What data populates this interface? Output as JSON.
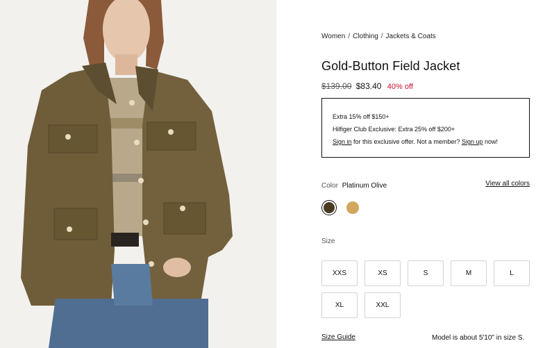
{
  "breadcrumb": {
    "items": [
      "Women",
      "Clothing",
      "Jackets & Coats"
    ],
    "separator": "/"
  },
  "product": {
    "title": "Gold-Button Field Jacket",
    "price_original": "$139.00",
    "price_sale": "$83.40",
    "discount": "40% off"
  },
  "promo": {
    "line1": "Extra 15% off $150+",
    "line2": "Hilfiger Club Exclusive: Extra 25% off $200+",
    "signin_link": "Sign in",
    "line3_middle": " for this exclusive offer. Not a member? ",
    "signup_link": "Sign up",
    "line3_end": " now!"
  },
  "color": {
    "label": "Color",
    "selected_name": "Platinum Olive",
    "view_all": "View all colors",
    "swatches": [
      {
        "name": "platinum-olive",
        "hex": "#4a3a22",
        "selected": true
      },
      {
        "name": "tan",
        "hex": "#d2a65c",
        "selected": false
      }
    ]
  },
  "size": {
    "label": "Size",
    "options": [
      "XXS",
      "XS",
      "S",
      "M",
      "L",
      "XL",
      "XXL"
    ],
    "guide": "Size Guide",
    "model_note": "Model is about 5'10\" in size S."
  },
  "colors": {
    "sale_red": "#c8102e",
    "text": "#111111",
    "border": "#d3d3d3"
  }
}
